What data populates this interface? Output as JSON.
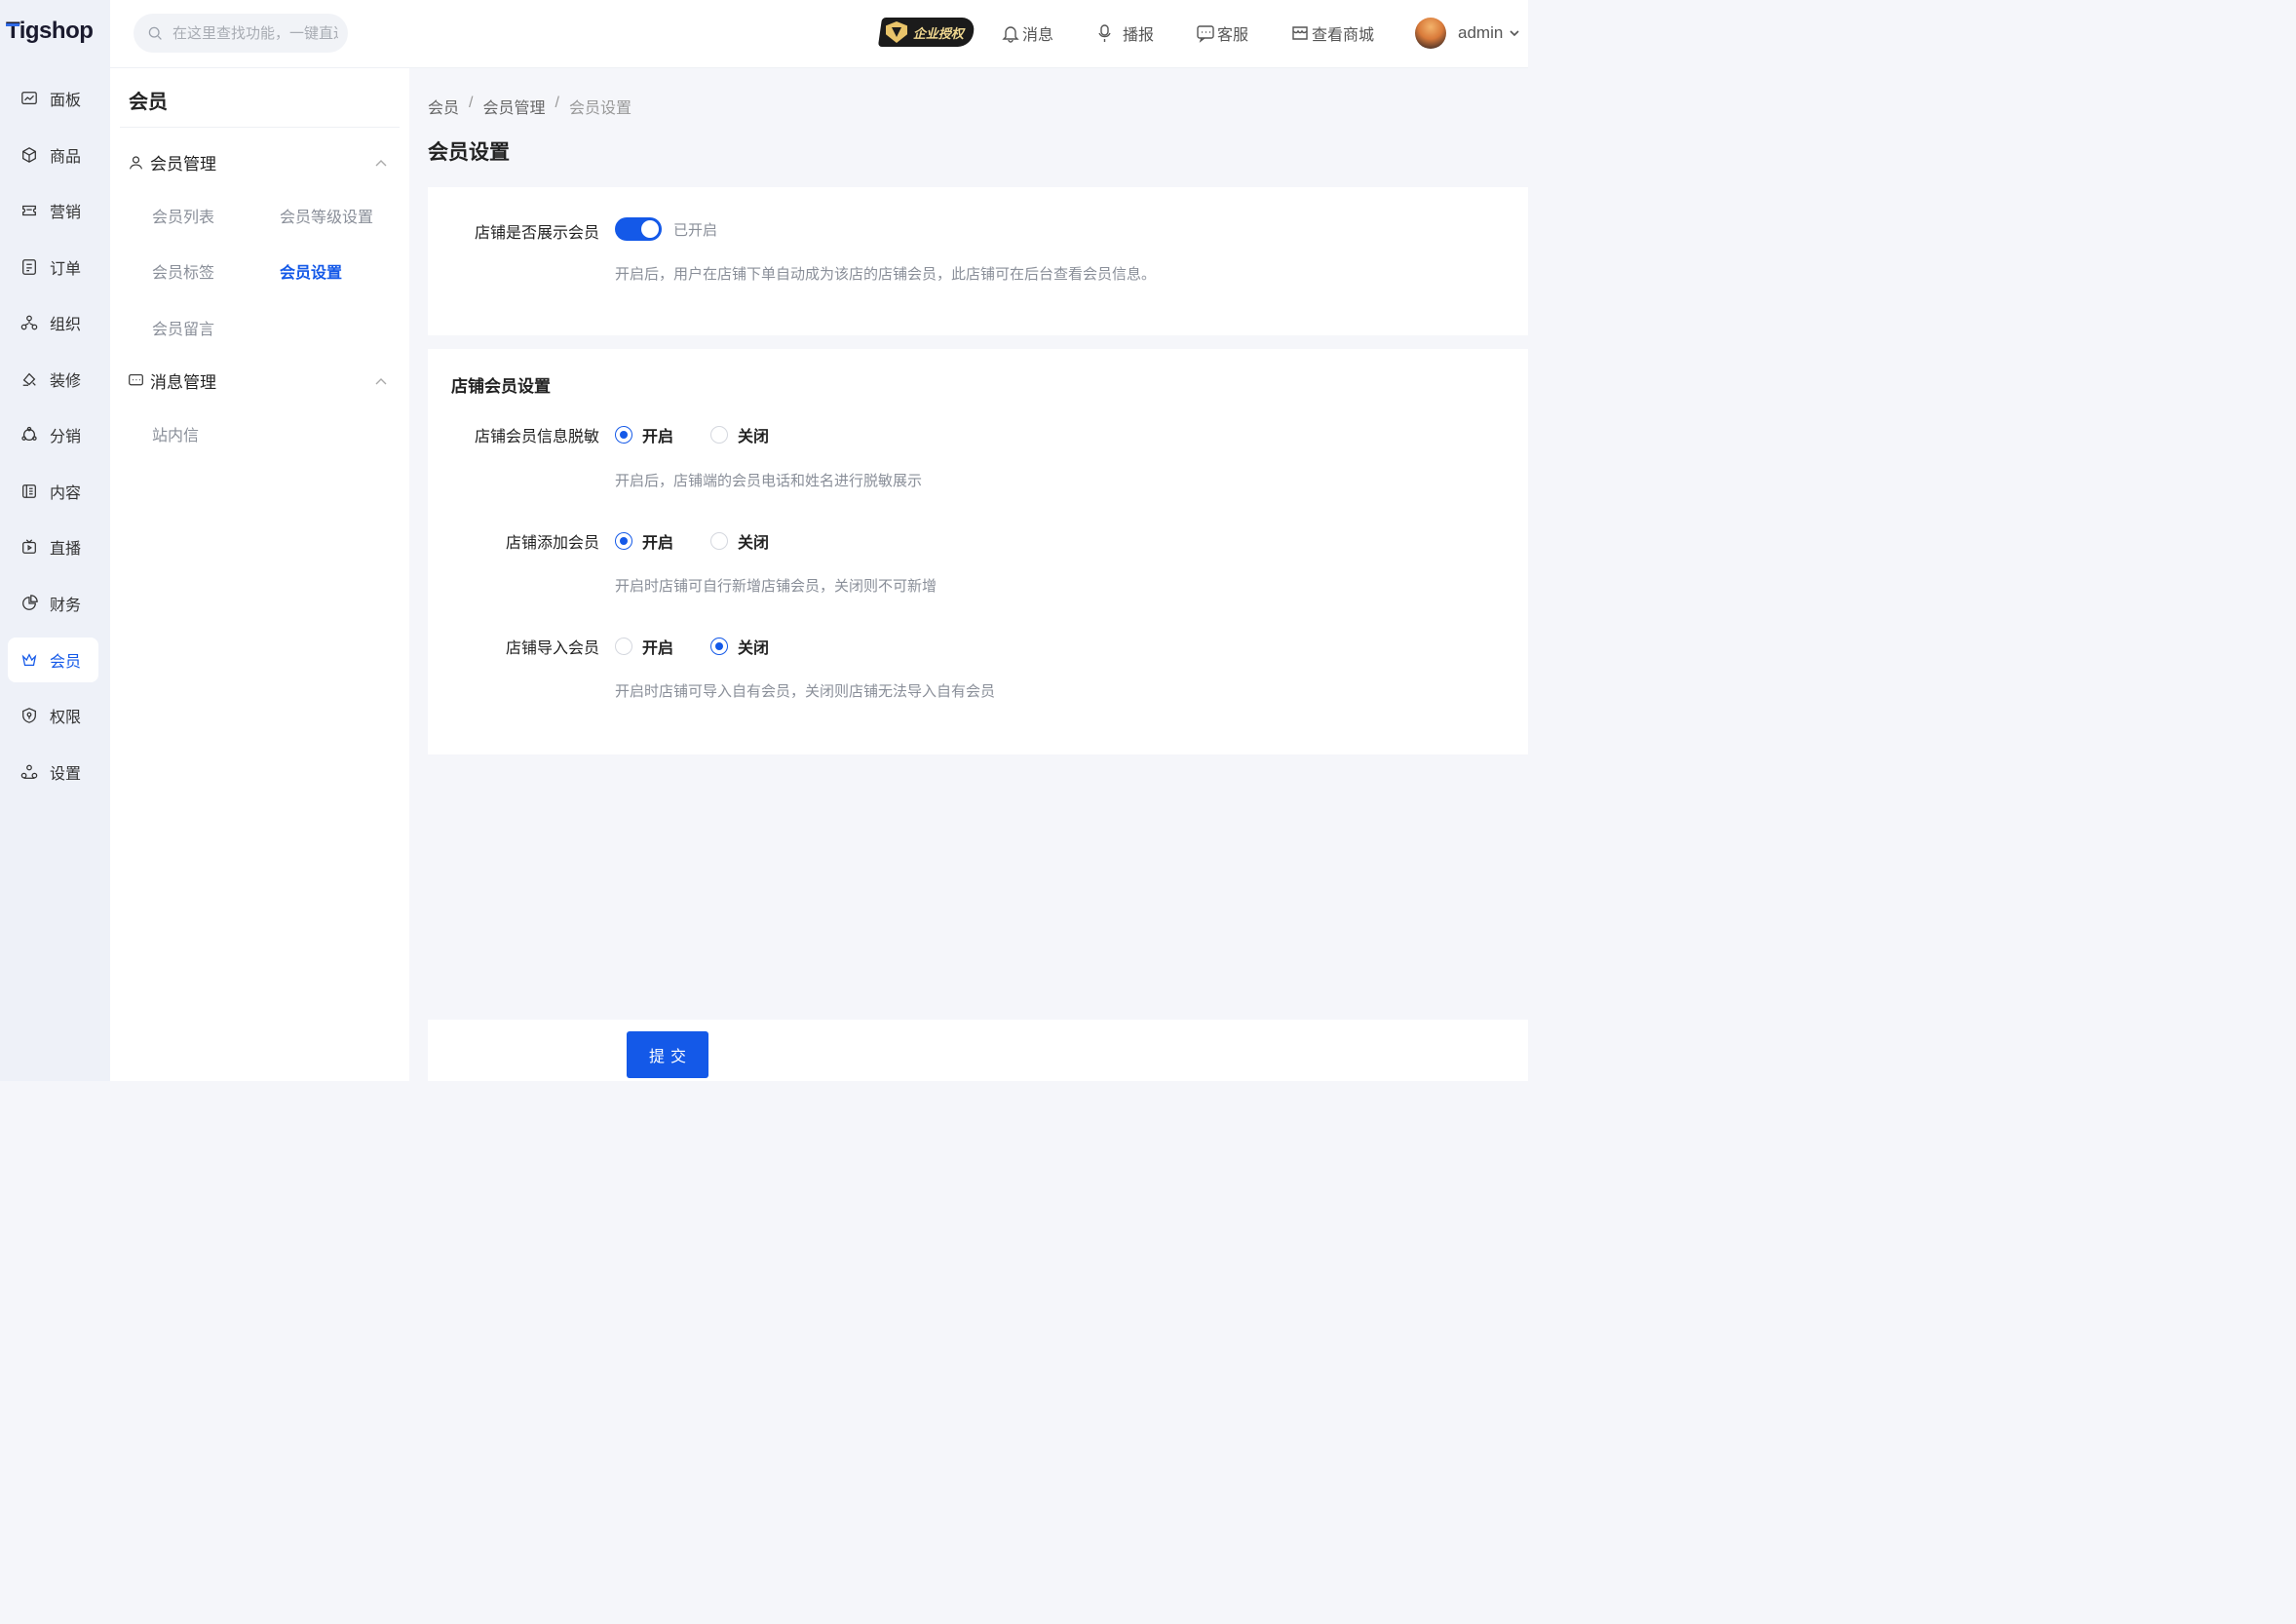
{
  "app": {
    "logo_text": "Tigshop",
    "search_placeholder": "在这里查找功能，一键直达"
  },
  "rail": {
    "items": [
      {
        "label": "面板",
        "icon": "dashboard-icon"
      },
      {
        "label": "商品",
        "icon": "box-icon"
      },
      {
        "label": "营销",
        "icon": "ticket-icon"
      },
      {
        "label": "订单",
        "icon": "order-icon"
      },
      {
        "label": "组织",
        "icon": "org-icon"
      },
      {
        "label": "装修",
        "icon": "paint-icon"
      },
      {
        "label": "分销",
        "icon": "share-icon"
      },
      {
        "label": "内容",
        "icon": "content-icon"
      },
      {
        "label": "直播",
        "icon": "live-icon"
      },
      {
        "label": "财务",
        "icon": "pie-icon"
      },
      {
        "label": "会员",
        "icon": "crown-icon",
        "active": true
      },
      {
        "label": "权限",
        "icon": "shield-icon"
      },
      {
        "label": "设置",
        "icon": "settings-icon"
      }
    ]
  },
  "topbar": {
    "badge_text": "企业授权",
    "messages": "消息",
    "broadcast": "播报",
    "service": "客服",
    "view_mall": "查看商城",
    "user_name": "admin"
  },
  "subnav": {
    "title": "会员",
    "group1": {
      "label": "会员管理",
      "links": [
        "会员列表",
        "会员等级设置",
        "会员标签",
        "会员设置",
        "会员留言"
      ]
    },
    "group2": {
      "label": "消息管理",
      "links": [
        "站内信"
      ]
    }
  },
  "main": {
    "breadcrumb": [
      "会员",
      "会员管理",
      "会员设置"
    ],
    "page_title": "会员设置",
    "show_member": {
      "label": "店铺是否展示会员",
      "switch_state": "已开启",
      "hint": "开启后，用户在店铺下单自动成为该店的店铺会员，此店铺可在后台查看会员信息。"
    },
    "store_settings": {
      "title": "店铺会员设置",
      "fields": [
        {
          "label": "店铺会员信息脱敏",
          "on_label": "开启",
          "off_label": "关闭",
          "selected": "开启",
          "hint": "开启后，店铺端的会员电话和姓名进行脱敏展示"
        },
        {
          "label": "店铺添加会员",
          "on_label": "开启",
          "off_label": "关闭",
          "selected": "开启",
          "hint": "开启时店铺可自行新增店铺会员，关闭则不可新增"
        },
        {
          "label": "店铺导入会员",
          "on_label": "开启",
          "off_label": "关闭",
          "selected": "关闭",
          "hint": "开启时店铺可导入自有会员，关闭则店铺无法导入自有会员"
        }
      ]
    },
    "submit_label": "提交"
  },
  "colors": {
    "accent": "#1459e8",
    "rail_bg": "#eef1f8",
    "page_bg": "#f5f6fa"
  }
}
